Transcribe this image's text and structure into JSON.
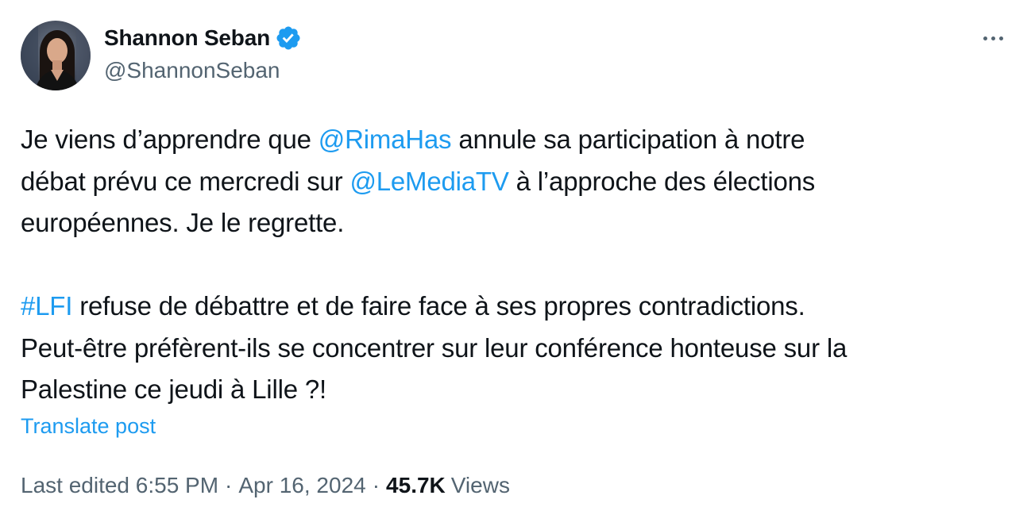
{
  "author": {
    "display_name": "Shannon Seban",
    "handle": "@ShannonSeban",
    "verified_icon": "verified-badge-icon"
  },
  "more_icon": "more-options-icon",
  "tweet": {
    "line1_pre": "Je viens d’apprendre que ",
    "mention1": "@RimaHas",
    "line1_post": " annule sa participation à notre",
    "line2_pre": "débat prévu ce mercredi sur ",
    "mention2": "@LeMediaTV",
    "line2_post": " à l’approche des élections",
    "line3": "européennes. Je le regrette.",
    "hashtag": "#LFI",
    "line4_post": " refuse de débattre et de faire face à ses propres contradictions.",
    "line5": "Peut-être préfèrent-ils se concentrer sur leur conférence honteuse sur la",
    "line6": "Palestine ce jeudi à Lille ?!"
  },
  "translate_label": "Translate post",
  "meta": {
    "edited_label": "Last edited 6:55 PM",
    "separator": "·",
    "date": "Apr 16, 2024",
    "views_count": "45.7K",
    "views_label": "Views"
  },
  "colors": {
    "link": "#1d9bf0",
    "text": "#0f1419",
    "secondary": "#536471",
    "verified": "#1d9bf0"
  }
}
